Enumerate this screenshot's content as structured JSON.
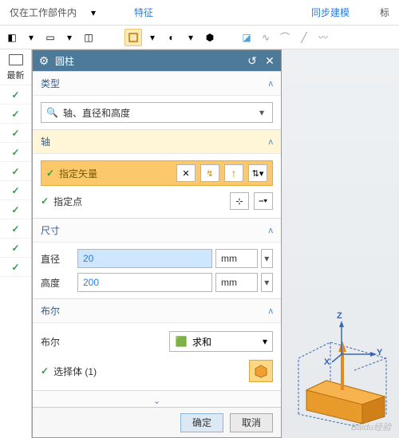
{
  "topbar": {
    "scope": "仅在工作部件内",
    "tab_feature": "特征",
    "tab_sync": "同步建模",
    "tab_right": "标"
  },
  "left": {
    "latest": "最新"
  },
  "panel": {
    "title": "圆柱",
    "type": {
      "header": "类型",
      "combo": "轴、直径和高度"
    },
    "axis": {
      "header": "轴",
      "vector": "指定矢量",
      "point": "指定点"
    },
    "dim": {
      "header": "尺寸",
      "diameter_label": "直径",
      "diameter_value": "20",
      "height_label": "高度",
      "height_value": "200",
      "unit": "mm"
    },
    "bool": {
      "header": "布尔",
      "label": "布尔",
      "combo": "求和",
      "select": "选择体 (1)"
    },
    "buttons": {
      "ok": "确定",
      "cancel": "取消"
    }
  },
  "viewport": {
    "axes": {
      "x": "X",
      "y": "Y",
      "z": "Z"
    }
  },
  "watermark": "Baidu经验"
}
